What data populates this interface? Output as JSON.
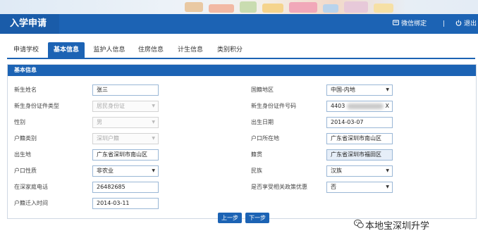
{
  "header": {
    "title": "入学申请",
    "wechat_bind": "微信绑定",
    "separator": "|",
    "logout": "退出"
  },
  "tabs": [
    {
      "label": "申请学校",
      "active": false
    },
    {
      "label": "基本信息",
      "active": true
    },
    {
      "label": "监护人信息",
      "active": false
    },
    {
      "label": "住房信息",
      "active": false
    },
    {
      "label": "计生信息",
      "active": false
    },
    {
      "label": "类别积分",
      "active": false
    }
  ],
  "panel": {
    "title": "基本信息"
  },
  "form": {
    "left": [
      {
        "label": "新生姓名",
        "value": "张三"
      },
      {
        "label": "新生身份证件类型",
        "value": "居民身份证"
      },
      {
        "label": "性别",
        "value": "男"
      },
      {
        "label": "户籍类别",
        "value": "深圳户籍"
      },
      {
        "label": "出生地",
        "value": "广东省深圳市南山区"
      },
      {
        "label": "户口性质",
        "value": "非农业"
      },
      {
        "label": "在深家庭电话",
        "value": "26482685"
      },
      {
        "label": "户籍迁入时间",
        "value": "2014-03-11"
      }
    ],
    "right": [
      {
        "label": "国籍地区",
        "value": "中国-内地"
      },
      {
        "label": "新生身份证件号码",
        "value_prefix": "4403",
        "value_suffix": "X"
      },
      {
        "label": "出生日期",
        "value": "2014-03-07"
      },
      {
        "label": "户口所在地",
        "value": "广东省深圳市南山区"
      },
      {
        "label": "籍贯",
        "value": "广东省深圳市福田区"
      },
      {
        "label": "民族",
        "value": "汉族"
      },
      {
        "label": "是否享受相关政策优惠",
        "value": "否"
      }
    ]
  },
  "buttons": {
    "prev": "上一步",
    "next": "下一步"
  },
  "watermark": "本地宝深圳升学",
  "colors": {
    "primary": "#1c63b4",
    "field_border": "#9ab7d6",
    "panel_border": "#cfd8e3"
  }
}
